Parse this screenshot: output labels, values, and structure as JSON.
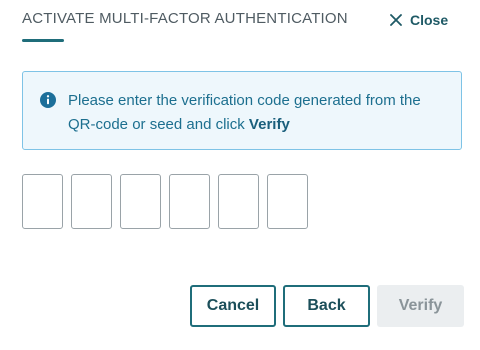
{
  "dialog": {
    "title": "ACTIVATE MULTI-FACTOR AUTHENTICATION",
    "close_label": "Close",
    "close_icon": "close-icon"
  },
  "info": {
    "icon": "info-icon",
    "message_before": "Please enter the verification code generated from the QR-code or seed and click ",
    "message_action": "Verify"
  },
  "code_inputs": [
    {
      "value": ""
    },
    {
      "value": ""
    },
    {
      "value": ""
    },
    {
      "value": ""
    },
    {
      "value": ""
    },
    {
      "value": ""
    }
  ],
  "buttons": {
    "cancel_label": "Cancel",
    "back_label": "Back",
    "verify_label": "Verify",
    "verify_disabled": true
  },
  "colors": {
    "accent": "#1f6d7a",
    "info_background": "#eef7fc",
    "info_border": "#7ec3e6",
    "info_text": "#1c6f8f",
    "disabled_background": "#ebeef0",
    "disabled_text": "#8a9499"
  }
}
